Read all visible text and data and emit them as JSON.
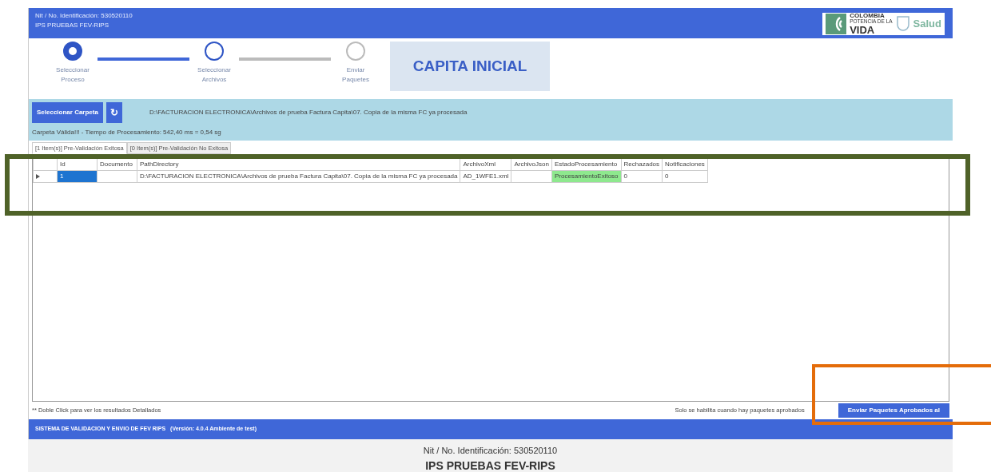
{
  "header": {
    "nit": "Nit / No. Identificación: 530520110",
    "ips": "IPS PRUEBAS FEV-RIPS",
    "logo": {
      "line1": "COLOMBIA",
      "line2": "POTENCIA DE LA",
      "line3": "VIDA",
      "line4": "Salud"
    }
  },
  "steps": [
    {
      "label": "Seleccionar Proceso",
      "done": true
    },
    {
      "label": "Seleccionar Archivos",
      "done": false
    },
    {
      "label": "Enviar Paquetes",
      "done": false
    }
  ],
  "connectors": [
    {
      "done": true
    },
    {
      "done": false
    }
  ],
  "process_title": "CAPITA INICIAL",
  "folder": {
    "button": "Seleccionar Carpeta",
    "refresh": "↻",
    "path": "D:\\FACTURACION ELECTRONICA\\Archivos de prueba Factura Capita\\07. Copia de la misma FC ya procesada",
    "status": "Carpeta Válida!!! - Tiempo de Procesamiento: 542,40 ms = 0,54 sg"
  },
  "tabs": [
    {
      "label": "[1 Item(s)] Pre-Validación Exitosa",
      "selected": true
    },
    {
      "label": "[0 Item(s)] Pre-Validación No Exitosa",
      "selected": false
    }
  ],
  "table": {
    "columns": [
      "Id",
      "Documento",
      "PathDirectory",
      "ArchivoXml",
      "ArchivoJson",
      "EstadoProcesamiento",
      "Rechazados",
      "Notificaciones"
    ],
    "rows": [
      {
        "selected": true,
        "cells": [
          "1",
          "",
          "D:\\FACTURACION ELECTRONICA\\Archivos de prueba Factura Capita\\07. Copia de la misma FC ya procesada",
          "AD_1WFE1.xml",
          "",
          "ProcesamientoExitoso",
          "0",
          "0"
        ],
        "success": true
      }
    ]
  },
  "hint": "** Doble Click para ver los resultados Detallados",
  "send_note": "Solo se habilita cuando hay paquetes aprobados",
  "send_button": "Enviar Paquetes Aprobados al",
  "status_bar": {
    "system": "SISTEMA DE VALIDACION Y ENVIO DE FEV RIPS",
    "version": "(Versión: 4.0.4 Ambiente de test)"
  },
  "bottom": {
    "nit": "Nit / No. Identificación: 530520110",
    "ips": "IPS PRUEBAS FEV-RIPS"
  }
}
